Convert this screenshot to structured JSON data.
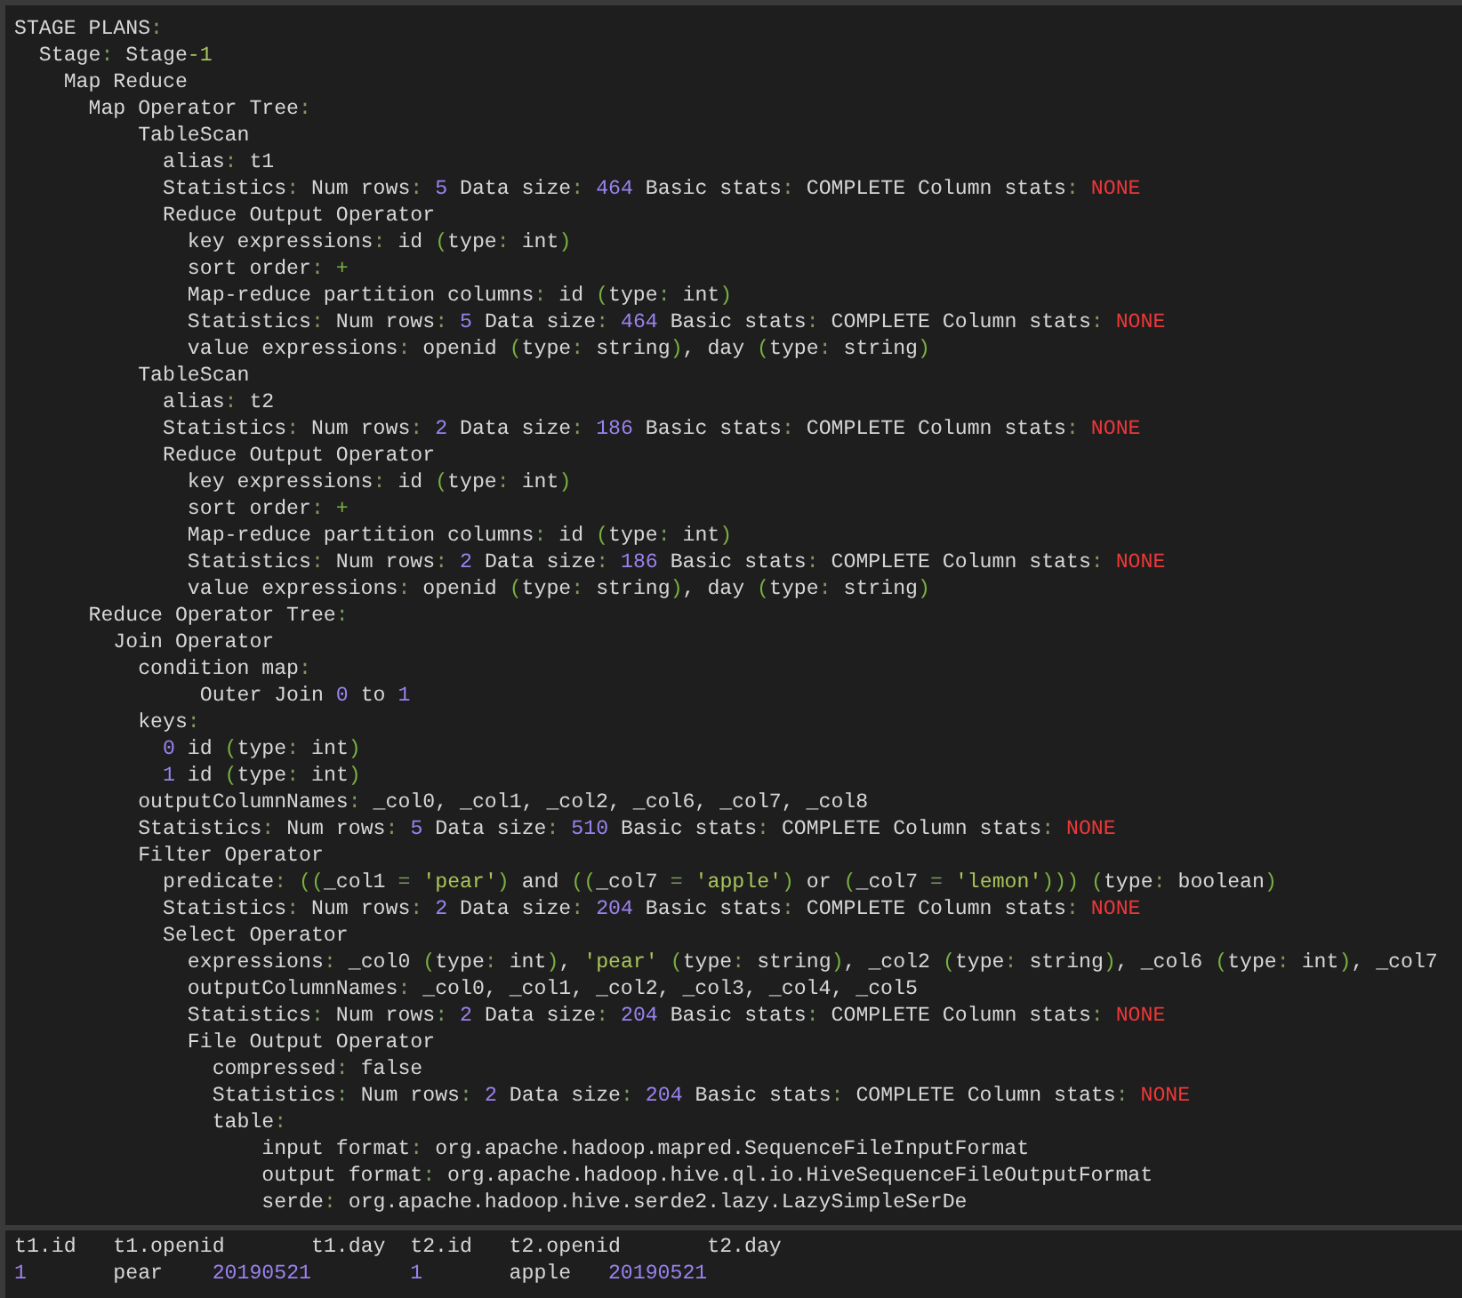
{
  "plan": {
    "lines": [
      [
        "STAGE PLANS:"
      ],
      [
        "  Stage: Stage",
        {
          "text": "-1",
          "kind": "str"
        }
      ],
      [
        "    Map Reduce"
      ],
      [
        "      Map Operator Tree:"
      ],
      [
        "          TableScan"
      ],
      [
        "            alias: t1"
      ],
      [
        "            Statistics: Num rows: ",
        {
          "text": "5",
          "kind": "num"
        },
        " Data size: ",
        {
          "text": "464",
          "kind": "num"
        },
        " Basic stats: COMPLETE Column stats: ",
        {
          "text": "NONE",
          "kind": "bad"
        }
      ],
      [
        "            Reduce Output Operator"
      ],
      [
        "              key expressions: id (type: int)"
      ],
      [
        "              sort order: +"
      ],
      [
        "              Map-reduce partition columns: id (type: int)"
      ],
      [
        "              Statistics: Num rows: ",
        {
          "text": "5",
          "kind": "num"
        },
        " Data size: ",
        {
          "text": "464",
          "kind": "num"
        },
        " Basic stats: COMPLETE Column stats: ",
        {
          "text": "NONE",
          "kind": "bad"
        }
      ],
      [
        "              value expressions: openid (type: string), day (type: string)"
      ],
      [
        "          TableScan"
      ],
      [
        "            alias: t2"
      ],
      [
        "            Statistics: Num rows: ",
        {
          "text": "2",
          "kind": "num"
        },
        " Data size: ",
        {
          "text": "186",
          "kind": "num"
        },
        " Basic stats: COMPLETE Column stats: ",
        {
          "text": "NONE",
          "kind": "bad"
        }
      ],
      [
        "            Reduce Output Operator"
      ],
      [
        "              key expressions: id (type: int)"
      ],
      [
        "              sort order: +"
      ],
      [
        "              Map-reduce partition columns: id (type: int)"
      ],
      [
        "              Statistics: Num rows: ",
        {
          "text": "2",
          "kind": "num"
        },
        " Data size: ",
        {
          "text": "186",
          "kind": "num"
        },
        " Basic stats: COMPLETE Column stats: ",
        {
          "text": "NONE",
          "kind": "bad"
        }
      ],
      [
        "              value expressions: openid (type: string), day (type: string)"
      ],
      [
        "      Reduce Operator Tree:"
      ],
      [
        "        Join Operator"
      ],
      [
        "          condition map:"
      ],
      [
        "               Outer Join ",
        {
          "text": "0",
          "kind": "num"
        },
        " to ",
        {
          "text": "1",
          "kind": "num"
        }
      ],
      [
        "          keys:"
      ],
      [
        {
          "text": "            0",
          "kind": "num"
        },
        " id (type: int)"
      ],
      [
        {
          "text": "            1",
          "kind": "num"
        },
        " id (type: int)"
      ],
      [
        "          outputColumnNames: _col0, _col1, _col2, _col6, _col7, _col8"
      ],
      [
        "          Statistics: Num rows: ",
        {
          "text": "5",
          "kind": "num"
        },
        " Data size: ",
        {
          "text": "510",
          "kind": "num"
        },
        " Basic stats: COMPLETE Column stats: ",
        {
          "text": "NONE",
          "kind": "bad"
        }
      ],
      [
        "          Filter Operator"
      ],
      [
        "            predicate: ((_col1 = ",
        {
          "text": "'pear'",
          "kind": "str"
        },
        ") and ((_col7 = ",
        {
          "text": "'apple'",
          "kind": "str"
        },
        ") or (_col7 = ",
        {
          "text": "'lemon'",
          "kind": "str"
        },
        "))) (type: boolean)"
      ],
      [
        "            Statistics: Num rows: ",
        {
          "text": "2",
          "kind": "num"
        },
        " Data size: ",
        {
          "text": "204",
          "kind": "num"
        },
        " Basic stats: COMPLETE Column stats: ",
        {
          "text": "NONE",
          "kind": "bad"
        }
      ],
      [
        "            Select Operator"
      ],
      [
        "              expressions: _col0 (type: int), ",
        {
          "text": "'pear'",
          "kind": "str"
        },
        " (type: string), _col2 (type: string), _col6 (type: int), _col7"
      ],
      [
        "              outputColumnNames: _col0, _col1, _col2, _col3, _col4, _col5"
      ],
      [
        "              Statistics: Num rows: ",
        {
          "text": "2",
          "kind": "num"
        },
        " Data size: ",
        {
          "text": "204",
          "kind": "num"
        },
        " Basic stats: COMPLETE Column stats: ",
        {
          "text": "NONE",
          "kind": "bad"
        }
      ],
      [
        "              File Output Operator"
      ],
      [
        "                compressed: false"
      ],
      [
        "                Statistics: Num rows: ",
        {
          "text": "2",
          "kind": "num"
        },
        " Data size: ",
        {
          "text": "204",
          "kind": "num"
        },
        " Basic stats: COMPLETE Column stats: ",
        {
          "text": "NONE",
          "kind": "bad"
        }
      ],
      [
        "                table:"
      ],
      [
        "                    input format: org.apache.hadoop.mapred.SequenceFileInputFormat"
      ],
      [
        "                    output format: org.apache.hadoop.hive.ql.io.HiveSequenceFileOutputFormat"
      ],
      [
        "                    serde: org.apache.hadoop.hive.serde2.lazy.LazySimpleSerDe"
      ]
    ]
  },
  "result": {
    "columns": [
      "t1.id",
      "t1.openid",
      "t1.day",
      "t2.id",
      "t2.openid",
      "t2.day"
    ],
    "rows": [
      [
        {
          "text": "1",
          "kind": "num"
        },
        {
          "text": "pear",
          "kind": "plain"
        },
        {
          "text": "20190521",
          "kind": "num"
        },
        {
          "text": "1",
          "kind": "num"
        },
        {
          "text": "apple",
          "kind": "plain"
        },
        {
          "text": "20190521",
          "kind": "num"
        }
      ]
    ]
  }
}
